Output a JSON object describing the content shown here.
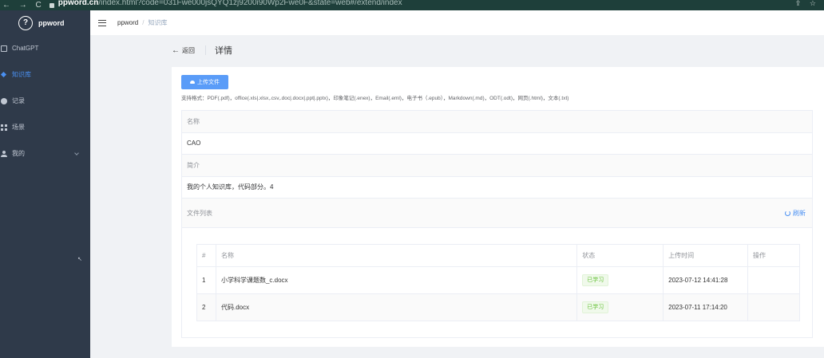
{
  "browser": {
    "nav": "← → C",
    "url_host": "ppword.cn",
    "url_path": "/index.html?code=031Fwe000jsQYQ1zj9200i90Wp2Fwe0F&state=web#/extend/index",
    "right": "⇪ ☆"
  },
  "sidebar": {
    "logo_mark": "?",
    "logo_text": "ppword",
    "items": [
      {
        "label": "ChatGPT",
        "icon": "chat-icon"
      },
      {
        "label": "知识库",
        "icon": "pin-icon",
        "active": true
      },
      {
        "label": "记录",
        "icon": "clock-icon"
      },
      {
        "label": "场景",
        "icon": "grid-icon"
      },
      {
        "label": "我的",
        "icon": "user-icon"
      }
    ]
  },
  "header": {
    "breadcrumb_home": "ppword",
    "breadcrumb_sep": "/",
    "breadcrumb_current": "知识库"
  },
  "page": {
    "back": "返回",
    "title": "详情"
  },
  "card": {
    "upload_label": "上传文件",
    "formats": "支持格式：PDF(.pdf)，office(.xls|.xlsx,.csv,.doc|.docx|.ppt|.pptx)，印象笔记(.enex)，Email(.eml)，电子书（.epub），Markdown(.md)，ODT(.odt)，网页(.html)，文本(.txt)",
    "name_label": "名称",
    "name_value": "CAO",
    "intro_label": "简介",
    "intro_value": "我的个人知识库，代码部分。4",
    "files_label": "文件列表",
    "refresh_label": "刷新"
  },
  "files": {
    "columns": [
      "#",
      "名称",
      "状态",
      "上传时间",
      "操作"
    ],
    "rows": [
      {
        "index": "1",
        "name": "小学科学课题数_c.docx",
        "status": "已学习",
        "uploaded": "2023-07-12 14:41:28",
        "action": ""
      },
      {
        "index": "2",
        "name": "代码.docx",
        "status": "已学习",
        "uploaded": "2023-07-11 17:14:20",
        "action": ""
      }
    ]
  },
  "colors": {
    "accent": "#4a90f2",
    "sidebar_bg": "#2f3a4a",
    "success": "#67c23a"
  }
}
